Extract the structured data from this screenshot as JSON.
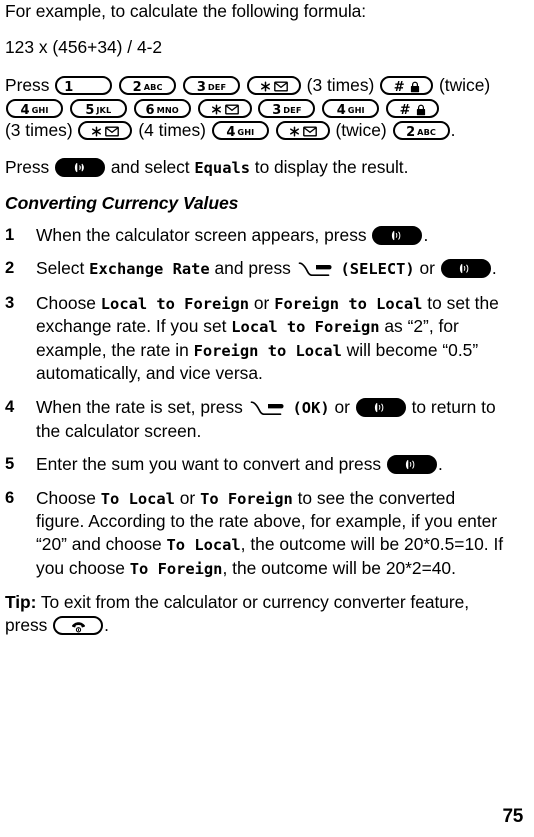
{
  "document": {
    "page_number": "75"
  },
  "intro": {
    "lead_text": "For example, to calculate the following formula:",
    "formula": "123 x (456+34) / 4-2",
    "press_label": "Press",
    "sequence": [
      {
        "type": "key",
        "key": "1",
        "digit": "1",
        "letters": ""
      },
      {
        "type": "key",
        "key": "2",
        "digit": "2",
        "letters": "ABC"
      },
      {
        "type": "key",
        "key": "3",
        "digit": "3",
        "letters": "DEF"
      },
      {
        "type": "key",
        "key": "star",
        "digit": "*",
        "letters": ""
      },
      {
        "type": "text",
        "text": "(3 times)"
      },
      {
        "type": "key",
        "key": "hash",
        "digit": "#",
        "letters": ""
      },
      {
        "type": "text",
        "text": "(twice)"
      },
      {
        "type": "key",
        "key": "4",
        "digit": "4",
        "letters": "GHI"
      },
      {
        "type": "key",
        "key": "5",
        "digit": "5",
        "letters": "JKL"
      },
      {
        "type": "key",
        "key": "6",
        "digit": "6",
        "letters": "MNO"
      },
      {
        "type": "key",
        "key": "star",
        "digit": "*",
        "letters": ""
      },
      {
        "type": "key",
        "key": "3",
        "digit": "3",
        "letters": "DEF"
      },
      {
        "type": "key",
        "key": "4",
        "digit": "4",
        "letters": "GHI"
      },
      {
        "type": "key",
        "key": "hash",
        "digit": "#",
        "letters": ""
      },
      {
        "type": "text",
        "text": "(3 times)"
      },
      {
        "type": "key",
        "key": "star",
        "digit": "*",
        "letters": ""
      },
      {
        "type": "text",
        "text": "(4 times)"
      },
      {
        "type": "key",
        "key": "4",
        "digit": "4",
        "letters": "GHI"
      },
      {
        "type": "key",
        "key": "star",
        "digit": "*",
        "letters": ""
      },
      {
        "type": "text",
        "text": "(twice)"
      },
      {
        "type": "key",
        "key": "2",
        "digit": "2",
        "letters": "ABC"
      },
      {
        "type": "text",
        "text": "."
      }
    ],
    "equals_line": {
      "before": "Press",
      "middle": "and select",
      "ui_value": "Equals",
      "after": "to display the result."
    }
  },
  "section": {
    "heading": "Converting Currency Values"
  },
  "steps": [
    {
      "num": "1",
      "parts": [
        {
          "t": "text",
          "v": "When the calculator screen appears, press "
        },
        {
          "t": "key-send"
        },
        {
          "t": "text",
          "v": "."
        }
      ]
    },
    {
      "num": "2",
      "parts": [
        {
          "t": "text",
          "v": "Select "
        },
        {
          "t": "ui",
          "v": "Exchange Rate"
        },
        {
          "t": "text",
          "v": " and press "
        },
        {
          "t": "softkey"
        },
        {
          "t": "text",
          "v": " "
        },
        {
          "t": "uiparen",
          "v": "(SELECT)"
        },
        {
          "t": "text",
          "v": " or "
        },
        {
          "t": "key-send"
        },
        {
          "t": "text",
          "v": "."
        }
      ]
    },
    {
      "num": "3",
      "parts": [
        {
          "t": "text",
          "v": "Choose "
        },
        {
          "t": "ui",
          "v": "Local to Foreign"
        },
        {
          "t": "text",
          "v": " or "
        },
        {
          "t": "ui",
          "v": "Foreign to Local"
        },
        {
          "t": "text",
          "v": " to set the exchange rate. If you set "
        },
        {
          "t": "ui",
          "v": "Local to Foreign"
        },
        {
          "t": "text",
          "v": " as “2”, for example, the rate in "
        },
        {
          "t": "ui",
          "v": "Foreign to Local"
        },
        {
          "t": "text",
          "v": " will become “0.5” automatically, and vice versa."
        }
      ]
    },
    {
      "num": "4",
      "parts": [
        {
          "t": "text",
          "v": "When the rate is set, press "
        },
        {
          "t": "softkey"
        },
        {
          "t": "text",
          "v": " "
        },
        {
          "t": "uiparen",
          "v": "(OK)"
        },
        {
          "t": "text",
          "v": " or "
        },
        {
          "t": "key-send"
        },
        {
          "t": "text",
          "v": " to return to the calculator screen."
        }
      ]
    },
    {
      "num": "5",
      "parts": [
        {
          "t": "text",
          "v": "Enter the sum you want to convert and press "
        },
        {
          "t": "key-send"
        },
        {
          "t": "text",
          "v": "."
        }
      ]
    },
    {
      "num": "6",
      "parts": [
        {
          "t": "text",
          "v": "Choose "
        },
        {
          "t": "ui",
          "v": "To Local"
        },
        {
          "t": "text",
          "v": " or "
        },
        {
          "t": "ui",
          "v": "To Foreign"
        },
        {
          "t": "text",
          "v": " to see the converted figure. According to the rate above, for example, if you enter “20” and choose "
        },
        {
          "t": "ui",
          "v": "To Local"
        },
        {
          "t": "text",
          "v": ", the outcome will be 20*0.5=10. If you choose "
        },
        {
          "t": "ui",
          "v": "To Foreign"
        },
        {
          "t": "text",
          "v": ", the outcome will be 20*2=40."
        }
      ]
    }
  ],
  "tip": {
    "label": "Tip:",
    "text_before": " To exit from the calculator or currency converter feature, press ",
    "text_after": "."
  },
  "icons": {
    "star_key": "star-envelope-icon",
    "hash_key": "hash-lock-icon",
    "send_key": "send-key-icon",
    "end_key": "end-key-icon",
    "softkey": "left-softkey-icon"
  }
}
